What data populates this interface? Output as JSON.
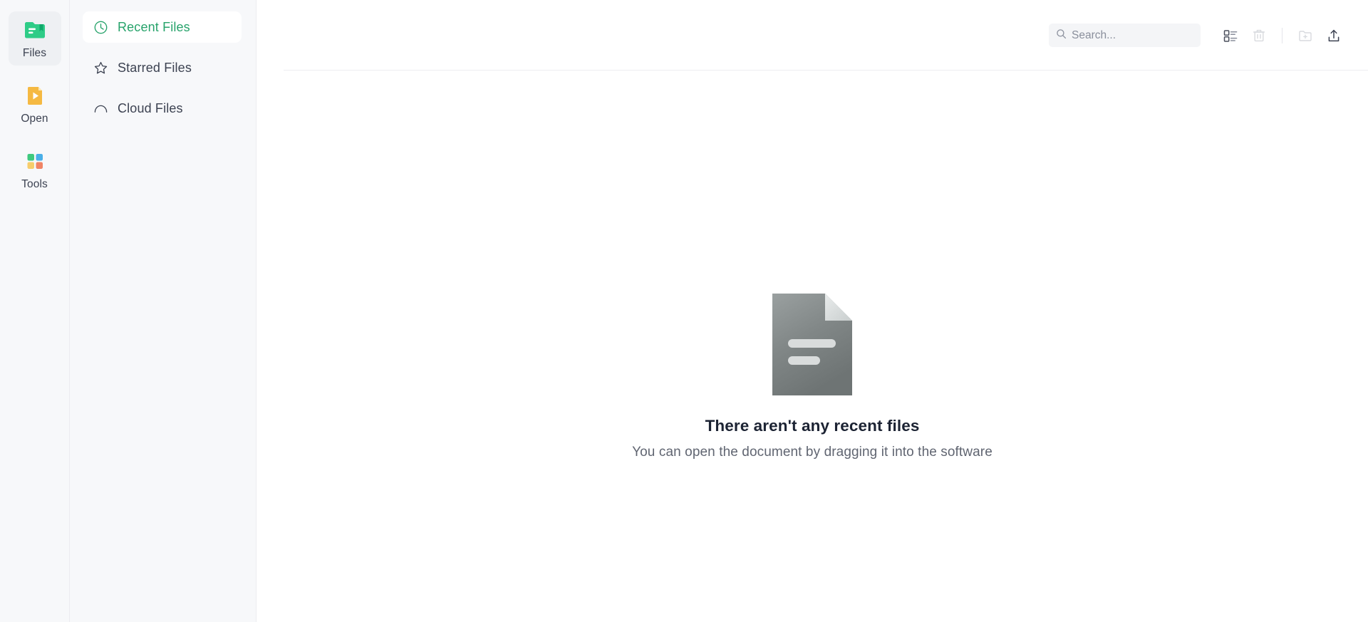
{
  "colors": {
    "accent_green": "#27a36b",
    "rail_bg": "#f7f8fa",
    "sidebar_bg": "#f7f8fa",
    "main_bg": "#ffffff",
    "divider": "#ececf0",
    "files_icon": "#2ecc87",
    "open_icon": "#f5b942",
    "tools_green": "#3ec97e",
    "tools_blue": "#4aafe8",
    "tools_yellow": "#f7cd6b",
    "tools_red": "#f08465",
    "title_text": "#1c2333",
    "sub_text": "#606571"
  },
  "rail": {
    "items": [
      {
        "label": "Files",
        "icon": "files-icon",
        "active": true
      },
      {
        "label": "Open",
        "icon": "open-icon",
        "active": false
      },
      {
        "label": "Tools",
        "icon": "tools-icon",
        "active": false
      }
    ]
  },
  "sidebar": {
    "items": [
      {
        "label": "Recent Files",
        "icon": "clock-icon",
        "active": true
      },
      {
        "label": "Starred Files",
        "icon": "star-icon",
        "active": false
      },
      {
        "label": "Cloud Files",
        "icon": "cloud-icon",
        "active": false
      }
    ]
  },
  "toolbar": {
    "search": {
      "value": "",
      "placeholder": "Search...",
      "icon": "search-icon"
    },
    "buttons": [
      {
        "name": "list-view-button",
        "icon": "list-view-icon",
        "enabled": true
      },
      {
        "name": "delete-button",
        "icon": "trash-icon",
        "enabled": false
      },
      {
        "name": "new-folder-button",
        "icon": "new-folder-icon",
        "enabled": false
      },
      {
        "name": "upload-button",
        "icon": "upload-icon",
        "enabled": true
      }
    ]
  },
  "empty_state": {
    "illustration": "document-icon",
    "title": "There aren't any recent files",
    "subtitle": "You can open the document by dragging it into the software"
  }
}
